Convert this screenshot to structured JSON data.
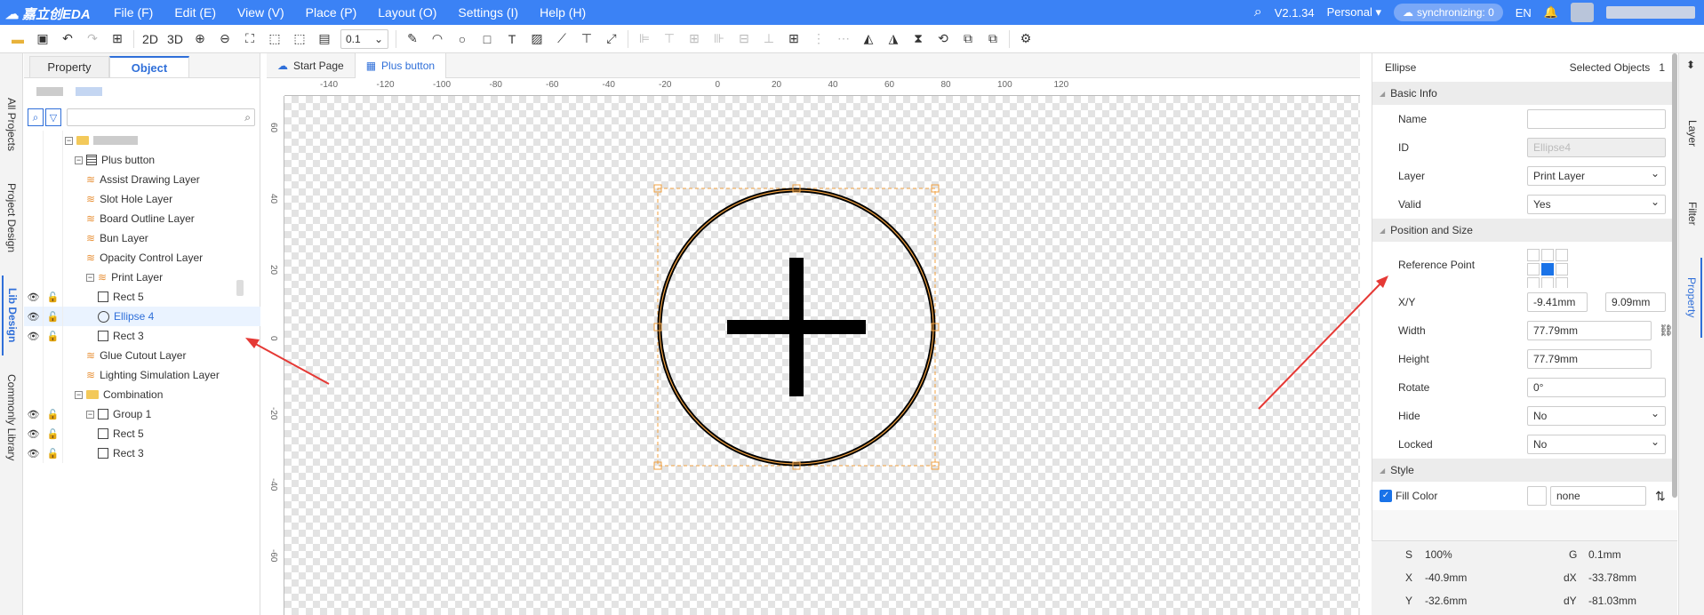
{
  "app": {
    "logo_text": "嘉立创EDA",
    "version": "V2.1.34",
    "edition": "Personal",
    "sync": "synchronizing: 0",
    "lang": "EN"
  },
  "menu": [
    "File (F)",
    "Edit (E)",
    "View (V)",
    "Place (P)",
    "Layout (O)",
    "Settings (I)",
    "Help (H)"
  ],
  "toolbar": {
    "view2d": "2D",
    "view3d": "3D",
    "grid_value": "0.1"
  },
  "left_vtabs": [
    "All Projects",
    "Project Design",
    "Lib Design",
    "Commonly Library"
  ],
  "left_tabs": [
    "Property",
    "Object"
  ],
  "tree": [
    {
      "label": "Plus button",
      "level": 1
    },
    {
      "label": "Assist Drawing Layer",
      "level": 2
    },
    {
      "label": "Slot Hole Layer",
      "level": 2
    },
    {
      "label": "Board Outline Layer",
      "level": 2
    },
    {
      "label": "Bun Layer",
      "level": 2
    },
    {
      "label": "Opacity Control Layer",
      "level": 2
    },
    {
      "label": "Print Layer",
      "level": 2
    },
    {
      "label": "Rect 5",
      "level": 3
    },
    {
      "label": "Ellipse 4",
      "level": 3
    },
    {
      "label": "Rect 3",
      "level": 3
    },
    {
      "label": "Glue Cutout Layer",
      "level": 2
    },
    {
      "label": "Lighting Simulation Layer",
      "level": 2
    },
    {
      "label": "Combination",
      "level": 1
    },
    {
      "label": "Group 1",
      "level": 2
    },
    {
      "label": "Rect 5",
      "level": 3
    },
    {
      "label": "Rect 3",
      "level": 3
    }
  ],
  "doc_tabs": [
    "Start Page",
    "Plus button"
  ],
  "ruler_x": [
    "-140",
    "-120",
    "-100",
    "-80",
    "-60",
    "-40",
    "-20",
    "0",
    "20",
    "40",
    "60",
    "80",
    "100",
    "120"
  ],
  "ruler_y": [
    "60",
    "40",
    "20",
    "0",
    "-20",
    "-40",
    "-60"
  ],
  "property": {
    "object_type": "Ellipse",
    "selected_label": "Selected Objects",
    "selected_count": "1",
    "basic_info": "Basic Info",
    "name_label": "Name",
    "name_value": "",
    "id_label": "ID",
    "id_value": "Ellipse4",
    "layer_label": "Layer",
    "layer_value": "Print Layer",
    "valid_label": "Valid",
    "valid_value": "Yes",
    "pos_size": "Position and Size",
    "ref_label": "Reference Point",
    "xy_label": "X/Y",
    "x_value": "-9.41mm",
    "y_value": "9.09mm",
    "width_label": "Width",
    "width_value": "77.79mm",
    "height_label": "Height",
    "height_value": "77.79mm",
    "rotate_label": "Rotate",
    "rotate_value": "0°",
    "hide_label": "Hide",
    "hide_value": "No",
    "locked_label": "Locked",
    "locked_value": "No",
    "style": "Style",
    "fill_label": "Fill Color",
    "fill_value": "none"
  },
  "status": {
    "s": "S",
    "s_val": "100%",
    "g": "G",
    "g_val": "0.1mm",
    "x": "X",
    "x_val": "-40.9mm",
    "dx": "dX",
    "dx_val": "-33.78mm",
    "y": "Y",
    "y_val": "-32.6mm",
    "dy": "dY",
    "dy_val": "-81.03mm"
  },
  "right_vtabs": [
    "Layer",
    "Filter",
    "Property"
  ],
  "colors": {
    "accent": "#3b82f5",
    "selection": "#f0a040",
    "arrow": "#e53935"
  }
}
